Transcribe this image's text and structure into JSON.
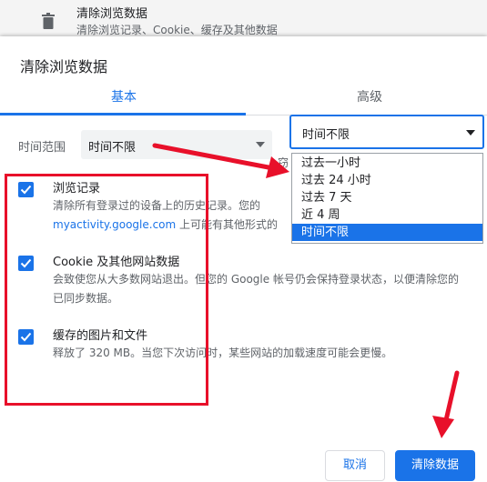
{
  "background_row": {
    "icon": "trash-icon",
    "title": "清除浏览数据",
    "subtitle": "清除浏览记录、Cookie、缓存及其他数据"
  },
  "dialog": {
    "title": "清除浏览数据",
    "tabs": [
      {
        "label": "基本",
        "active": true
      },
      {
        "label": "高级",
        "active": false
      }
    ],
    "time_range": {
      "label": "时间范围",
      "value": "时间不限",
      "options": [
        "过去一小时",
        "过去 24 小时",
        "过去 7 天",
        "近 4 周",
        "时间不限"
      ],
      "selected_index": 4
    },
    "items": [
      {
        "title": "浏览记录",
        "checked": true,
        "desc_line1": "清除所有登录过的设备上的历史记录。您的",
        "desc_link": "myactivity.google.com",
        "desc_line2_rest": " 上可能有其他形式的"
      },
      {
        "title": "Cookie 及其他网站数据",
        "checked": true,
        "desc": "会致使您从大多数网站退出。但您的 Google 帐号仍会保持登录状态，以便清除您的已同步数据。"
      },
      {
        "title": "缓存的图片和文件",
        "checked": true,
        "desc": "释放了 320 MB。当您下次访问时，某些网站的加载速度可能会更慢。"
      }
    ],
    "partial_text": "窃",
    "buttons": {
      "cancel": "取消",
      "clear": "清除数据"
    }
  },
  "colors": {
    "accent": "#1a73e8",
    "annotation_red": "#e8102a"
  }
}
